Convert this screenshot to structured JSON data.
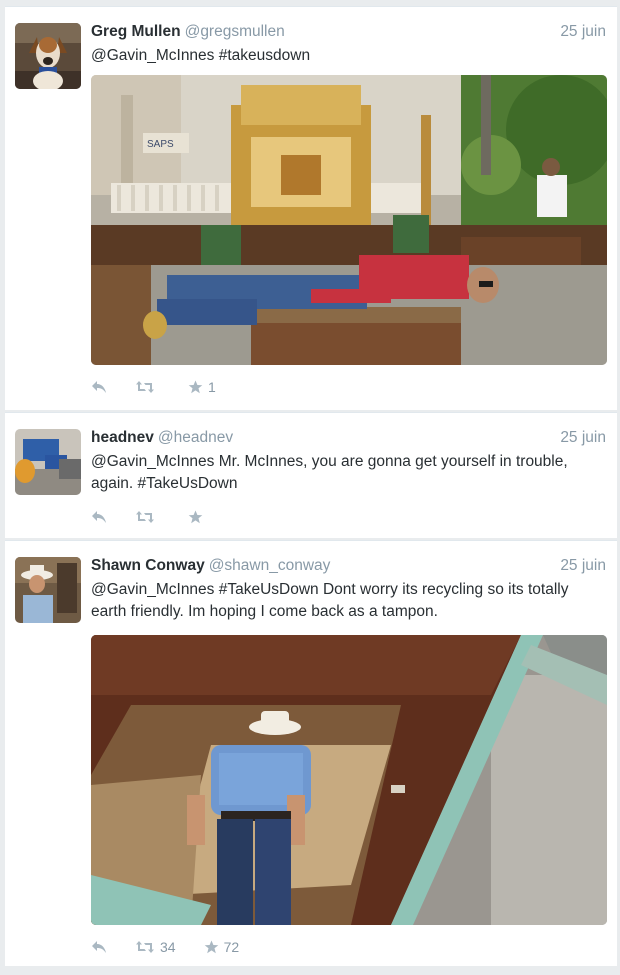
{
  "tweets": [
    {
      "name": "Greg Mullen",
      "handle": "@gregsmullen",
      "date": "25 juin",
      "text": "@Gavin_McInnes #takeusdown",
      "retweets": "",
      "favorites": "1",
      "media_sign": "SAPS"
    },
    {
      "name": "headnev",
      "handle": "@headnev",
      "date": "25 juin",
      "text": "@Gavin_McInnes Mr. McInnes, you are gonna get yourself in trouble, again.  #TakeUsDown",
      "retweets": "",
      "favorites": ""
    },
    {
      "name": "Shawn Conway",
      "handle": "@shawn_conway",
      "date": "25 juin",
      "text": "@Gavin_McInnes #TakeUsDown Dont worry its recycling so its totally earth friendly. Im hoping I come back as a tampon.",
      "retweets": "34",
      "favorites": "72"
    }
  ],
  "icons": {
    "reply": "reply-icon",
    "retweet": "retweet-icon",
    "favorite": "star-icon"
  },
  "colors": {
    "background": "#e9ecee",
    "card": "#ffffff",
    "name": "#292f33",
    "muted": "#8899a6",
    "icon": "#aab8c2"
  }
}
